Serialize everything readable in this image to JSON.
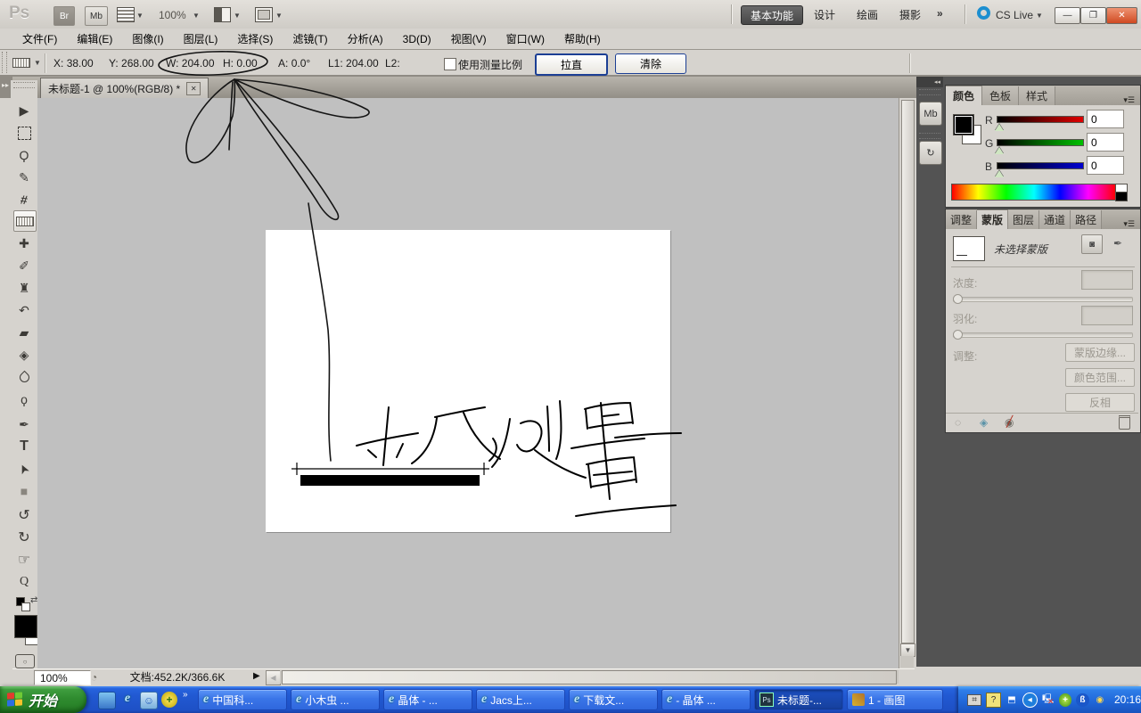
{
  "window": {
    "min_glyph": "—",
    "restore_glyph": "❐",
    "close_glyph": "✕"
  },
  "titlebar": {
    "logo": "Ps",
    "br_label": "Br",
    "mb_label": "Mb",
    "zoom_value": "100%",
    "workspaces": [
      {
        "label": "基本功能",
        "active": true
      },
      {
        "label": "设计",
        "active": false
      },
      {
        "label": "绘画",
        "active": false
      },
      {
        "label": "摄影",
        "active": false
      }
    ],
    "overflow_glyph": "»",
    "cs_live_label": "CS Live"
  },
  "menubar": {
    "items": [
      {
        "label": "文件(F)"
      },
      {
        "label": "编辑(E)"
      },
      {
        "label": "图像(I)"
      },
      {
        "label": "图层(L)"
      },
      {
        "label": "选择(S)"
      },
      {
        "label": "滤镜(T)"
      },
      {
        "label": "分析(A)"
      },
      {
        "label": "3D(D)"
      },
      {
        "label": "视图(V)"
      },
      {
        "label": "窗口(W)"
      },
      {
        "label": "帮助(H)"
      }
    ]
  },
  "options_bar": {
    "x_label": "X:",
    "x_value": "38.00",
    "y_label": "Y:",
    "y_value": "268.00",
    "w_label": "W:",
    "w_value": "204.00",
    "h_label": "H:",
    "h_value": "0.00",
    "a_label": "A:",
    "a_value": "0.0°",
    "l1_label": "L1:",
    "l1_value": "204.00",
    "l2_label": "L2:",
    "l2_value": "",
    "use_scale_label": "使用测量比例",
    "straighten_button": "拉直",
    "clear_button": "清除"
  },
  "document_tab": {
    "title": "未标题-1 @ 100%(RGB/8) *",
    "close_glyph": "✕",
    "collapse_glyph": "▸▸"
  },
  "toolbar": {
    "tools": [
      {
        "name": "move-tool",
        "glyph": "▶"
      },
      {
        "name": "rectangular-marquee-tool",
        "glyph": ""
      },
      {
        "name": "lasso-tool",
        "glyph": "Ϙ"
      },
      {
        "name": "quick-selection-tool",
        "glyph": "✎"
      },
      {
        "name": "crop-tool",
        "glyph": "#"
      },
      {
        "name": "ruler-tool",
        "glyph": ""
      },
      {
        "name": "spot-healing-brush-tool",
        "glyph": "✚"
      },
      {
        "name": "brush-tool",
        "glyph": "✐"
      },
      {
        "name": "clone-stamp-tool",
        "glyph": "♜"
      },
      {
        "name": "history-brush-tool",
        "glyph": "↶"
      },
      {
        "name": "eraser-tool",
        "glyph": "▰"
      },
      {
        "name": "gradient-tool",
        "glyph": "◈"
      },
      {
        "name": "blur-tool",
        "glyph": ""
      },
      {
        "name": "dodge-tool",
        "glyph": "ϙ"
      },
      {
        "name": "pen-tool",
        "glyph": "✒"
      },
      {
        "name": "type-tool",
        "glyph": "T"
      },
      {
        "name": "path-selection-tool",
        "glyph": "➤"
      },
      {
        "name": "rectangle-tool",
        "glyph": "■"
      },
      {
        "name": "3d-rotate-tool",
        "glyph": "↺"
      },
      {
        "name": "3d-orbit-tool",
        "glyph": "↻"
      },
      {
        "name": "hand-tool",
        "glyph": "☞"
      },
      {
        "name": "zoom-tool",
        "glyph": "Q"
      }
    ]
  },
  "dock_strip": {
    "collapse_glyph": "◂◂",
    "mini_bridge_label": "Mb",
    "history_glyph": "↻"
  },
  "color_panel": {
    "tabs": [
      {
        "label": "颜色",
        "active": true
      },
      {
        "label": "色板",
        "active": false
      },
      {
        "label": "样式",
        "active": false
      }
    ],
    "menu_glyph": "▾☰",
    "channels": [
      {
        "label": "R",
        "value": "0"
      },
      {
        "label": "G",
        "value": "0"
      },
      {
        "label": "B",
        "value": "0"
      }
    ]
  },
  "mask_panel": {
    "tabs": [
      {
        "label": "调整",
        "active": false
      },
      {
        "label": "蒙版",
        "active": true
      },
      {
        "label": "图层",
        "active": false
      },
      {
        "label": "通道",
        "active": false
      },
      {
        "label": "路径",
        "active": false
      }
    ],
    "menu_glyph": "▾☰",
    "no_mask_text": "未选择蒙版",
    "density_label": "浓度:",
    "feather_label": "羽化:",
    "refine_label": "调整:",
    "mask_edge_button": "蒙版边缘...",
    "color_range_button": "颜色范围...",
    "invert_button": "反相",
    "footer_icons": [
      "load-selection-icon",
      "apply-mask-icon",
      "disable-mask-icon",
      "delete-mask-icon"
    ]
  },
  "status_bar": {
    "zoom_value": "100%",
    "doc_info": "文档:452.2K/366.6K",
    "expand_glyph": "▶"
  },
  "canvas_annotations": {
    "handwriting_text": "标尺测量",
    "measured_width": "204.00",
    "circled_values": "W: 204.00  H: 0.00"
  },
  "taskbar": {
    "start_label": "开始",
    "quick_launch": [
      "show-desktop-icon",
      "internet-explorer-icon",
      "messenger-icon",
      "update-icon"
    ],
    "overflow_glyph": "»",
    "tasks": [
      {
        "icon": "ie",
        "label": "中国科...",
        "active": false
      },
      {
        "icon": "ie",
        "label": "小木虫 ...",
        "active": false
      },
      {
        "icon": "ie",
        "label": "晶体 - ...",
        "active": false
      },
      {
        "icon": "ie",
        "label": "Jacs上...",
        "active": false
      },
      {
        "icon": "ie",
        "label": "下载文...",
        "active": false
      },
      {
        "icon": "ie",
        "label": "- 晶体 ...",
        "active": false
      },
      {
        "icon": "ps",
        "label": "未标题-...",
        "active": true
      },
      {
        "icon": "paint",
        "label": "1 - 画图",
        "active": false
      }
    ],
    "clock": "20:16"
  },
  "colors": {
    "chrome_gray": "#d6d3ce",
    "dock_gray": "#535353",
    "canvas_gray": "#c0c0c0",
    "taskbar_blue": "#2159d2",
    "start_green": "#2f8b2f",
    "close_red": "#cf4a22",
    "slider_r": "#e00000",
    "slider_g": "#00c000",
    "slider_b": "#0000d0"
  }
}
